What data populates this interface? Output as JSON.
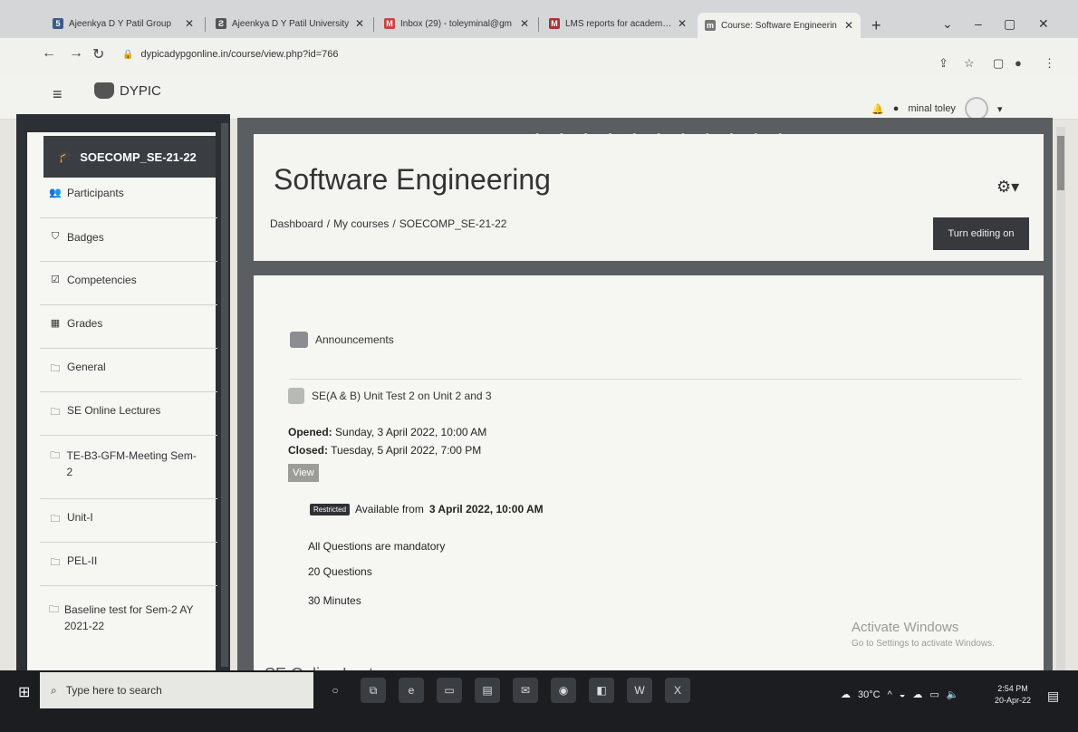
{
  "browser": {
    "tabs": [
      {
        "title": "Ajeenkya D Y Patil Group",
        "active": false
      },
      {
        "title": "Ajeenkya D Y Patil University",
        "active": false
      },
      {
        "title": "Inbox (29) - toleyminal@gm",
        "active": false
      },
      {
        "title": "LMS reports for academic ye",
        "active": false
      },
      {
        "title": "Course: Software Engineerin",
        "active": true
      }
    ],
    "new_tab": "+",
    "url": "dypicadypgonline.in/course/view.php?id=766",
    "window_controls": [
      "⌄",
      "–",
      "▢",
      "✕"
    ]
  },
  "navbar": {
    "site_name": "DYPIC",
    "user_name": "minal toley"
  },
  "drawer": {
    "course_shortname": "SOECOMP_SE-21-22",
    "items": [
      {
        "label": "Participants",
        "icon": "users-icon"
      },
      {
        "label": "Badges",
        "icon": "badge-icon"
      },
      {
        "label": "Competencies",
        "icon": "check-square-icon"
      },
      {
        "label": "Grades",
        "icon": "table-icon"
      },
      {
        "label": "General",
        "icon": "folder-icon"
      },
      {
        "label": "SE Online Lectures",
        "icon": "folder-icon"
      },
      {
        "label": "TE-B3-GFM-Meeting Sem-2",
        "icon": "folder-icon"
      },
      {
        "label": "Unit-I",
        "icon": "folder-icon"
      },
      {
        "label": "PEL-II",
        "icon": "folder-icon"
      },
      {
        "label": "Baseline test for Sem-2 AY 2021-22",
        "icon": "folder-icon"
      }
    ]
  },
  "header": {
    "title": "Software Engineering",
    "breadcrumb": [
      "Dashboard",
      "My courses",
      "SOECOMP_SE-21-22"
    ],
    "breadcrumb_sep": "/",
    "turn_editing": "Turn editing on"
  },
  "content": {
    "announcements": "Announcements",
    "quiz": {
      "title": "SE(A & B) Unit Test 2 on Unit 2 and 3",
      "opened_label": "Opened:",
      "opened_value": "Sunday, 3 April 2022, 10:00 AM",
      "closed_label": "Closed:",
      "closed_value": "Tuesday, 5 April 2022, 7:00 PM",
      "view_button": "View",
      "restricted_badge": "Restricted",
      "available_text": "Available from",
      "available_date": "3 April 2022, 10:00 AM",
      "info_lines": [
        "All Questions are mandatory",
        "20 Questions",
        "30 Minutes"
      ]
    },
    "next_section": "SE Online Lectures",
    "watermark": {
      "title": "Activate Windows",
      "subtitle": "Go to Settings to activate Windows."
    }
  },
  "taskbar": {
    "search_placeholder": "Type here to search",
    "weather": "30°C",
    "time": "2:54 PM",
    "date": "20-Apr-22"
  },
  "colors": {
    "drawer_bg": "#2c2f33",
    "frame_bg": "#5b5e61",
    "card_bg": "#f6f6f3",
    "button_dark": "#37393c"
  }
}
